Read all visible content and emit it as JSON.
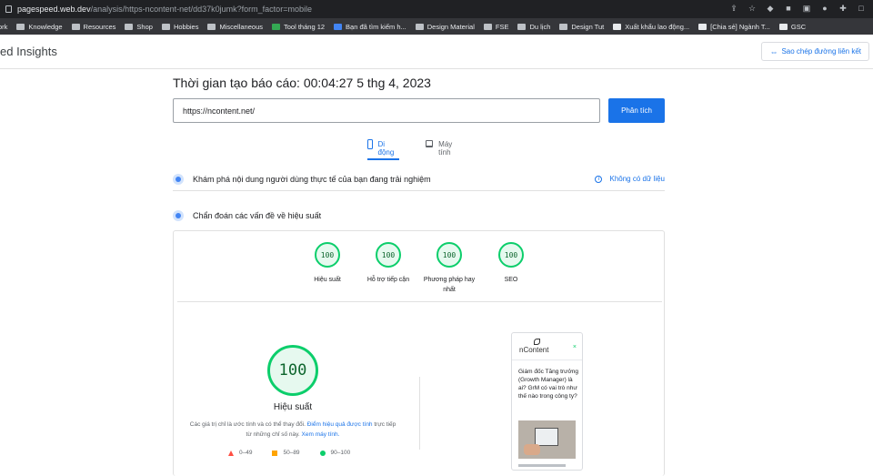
{
  "browser": {
    "url_host": "pagespeed.web.dev",
    "url_path": "/analysis/https-ncontent-net/dd37k0jumk?form_factor=mobile",
    "bookmarks": [
      "ork",
      "Knowledge",
      "Resources",
      "Shop",
      "Hobbies",
      "Miscellaneous",
      "Tool tháng 12",
      "Bạn đã tìm kiếm h...",
      "Design Material",
      "FSE",
      "Du lịch",
      "Design Tut",
      "Xuất khẩu lao động...",
      "[Chia sẻ] Ngành T...",
      "GSC"
    ]
  },
  "header": {
    "title": "ed Insights",
    "copy_link_label": "Sao chép đường liên kết"
  },
  "report": {
    "time_label": "Thời gian tạo báo cáo: 00:04:27 5 thg 4, 2023",
    "url_value": "https://ncontent.net/",
    "analyze_label": "Phân tích"
  },
  "tabs": {
    "mobile": "Di động",
    "desktop": "Máy tính"
  },
  "crux": {
    "label": "Khám phá nội dung người dùng thực tế của bạn đang trải nghiệm",
    "no_data": "Không có dữ liệu"
  },
  "diagnose": {
    "label": "Chẩn đoán các vấn đề về hiệu suất"
  },
  "scores": [
    {
      "value": "100",
      "label": "Hiệu suất"
    },
    {
      "value": "100",
      "label": "Hỗ trợ tiếp cận"
    },
    {
      "value": "100",
      "label": "Phương pháp hay nhất"
    },
    {
      "value": "100",
      "label": "SEO"
    }
  ],
  "performance": {
    "score": "100",
    "label": "Hiệu suất",
    "note_prefix": "Các giá trị chỉ là ước tính và có thể thay đổi.",
    "note_link": "Điểm hiệu quả được tính",
    "note_mid": "trực tiếp từ những chỉ số này.",
    "note_link2": "Xem máy tính."
  },
  "legend": [
    {
      "range": "0–49",
      "color": "#ff4e42"
    },
    {
      "range": "50–89",
      "color": "#ffa400"
    },
    {
      "range": "90–100",
      "color": "#0cce6b"
    }
  ],
  "screenshot": {
    "brand": "nContent",
    "headline": "Giám đốc Tăng trưởng (Growth Manager) là ai? GrM có vai trò như thế nào trong công ty?"
  }
}
